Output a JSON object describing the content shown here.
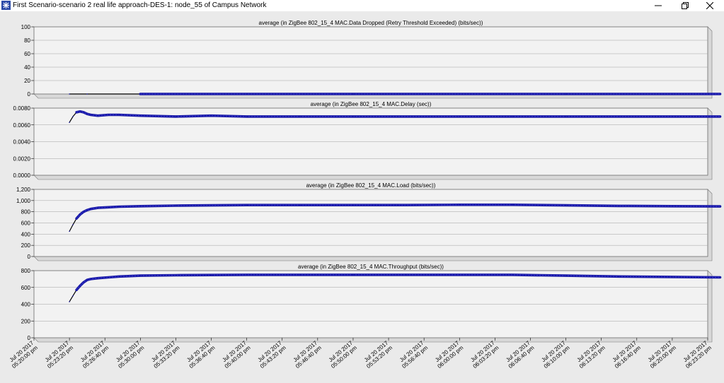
{
  "window": {
    "title": "First Scenario-scenario 2 real life approach-DES-1: node_55 of Campus Network",
    "minimize_icon": "minimize-icon",
    "maximize_icon": "restore-icon",
    "close_icon": "close-icon"
  },
  "colors": {
    "background": "#eaeaea",
    "panel": "#f2f2f2",
    "series": "#1a1aa8",
    "initial_segment": "#000000",
    "grid": "#a0a0a0"
  },
  "chart_data": [
    {
      "type": "line",
      "title": "average (in ZigBee 802_15_4 MAC.Data Dropped (Retry Threshold Exceeded) (bits/sec))",
      "ylim": [
        0,
        100
      ],
      "yticks": [
        0,
        20,
        40,
        60,
        80,
        100
      ],
      "ytick_labels": [
        "0",
        "20",
        "40",
        "60",
        "80",
        "100"
      ],
      "grid": true,
      "x": [
        "05:23:20",
        "05:25:00",
        "05:30:00",
        "05:40:00",
        "05:50:00",
        "06:00:00",
        "06:10:00",
        "06:20:00",
        "06:24:30"
      ],
      "series": [
        {
          "values": [
            0,
            0,
            0,
            0,
            0,
            0,
            0,
            0,
            0
          ]
        }
      ]
    },
    {
      "type": "line",
      "title": "average (in ZigBee 802_15_4 MAC.Delay (sec))",
      "ylim": [
        0,
        0.008
      ],
      "yticks": [
        0,
        0.002,
        0.004,
        0.006,
        0.008
      ],
      "ytick_labels": [
        "0.0000",
        "0.0020",
        "0.0040",
        "0.0060",
        "0.0080"
      ],
      "grid": true,
      "x": [
        "05:23:20",
        "05:23:40",
        "05:24:00",
        "05:24:20",
        "05:24:40",
        "05:25:00",
        "05:25:20",
        "05:26:00",
        "05:27:00",
        "05:28:00",
        "05:30:00",
        "05:33:20",
        "05:36:40",
        "05:40:00",
        "05:45:00",
        "05:50:00",
        "05:55:00",
        "06:00:00",
        "06:05:00",
        "06:10:00",
        "06:15:00",
        "06:20:00",
        "06:24:30"
      ],
      "series": [
        {
          "values": [
            0.0063,
            0.007,
            0.0075,
            0.0076,
            0.0075,
            0.0073,
            0.0072,
            0.0071,
            0.0072,
            0.0072,
            0.0071,
            0.007,
            0.0071,
            0.007,
            0.007,
            0.007,
            0.007,
            0.007,
            0.007,
            0.007,
            0.007,
            0.007,
            0.007
          ]
        }
      ]
    },
    {
      "type": "line",
      "title": "average (in ZigBee 802_15_4 MAC.Load (bits/sec))",
      "ylim": [
        0,
        1200
      ],
      "yticks": [
        0,
        200,
        400,
        600,
        800,
        1000,
        1200
      ],
      "ytick_labels": [
        "0",
        "200",
        "400",
        "600",
        "800",
        "1,000",
        "1,200"
      ],
      "grid": true,
      "x": [
        "05:23:20",
        "05:23:40",
        "05:24:00",
        "05:24:20",
        "05:24:40",
        "05:25:00",
        "05:25:20",
        "05:26:00",
        "05:27:00",
        "05:28:00",
        "05:30:00",
        "05:33:20",
        "05:36:40",
        "05:40:00",
        "05:45:00",
        "05:50:00",
        "05:55:00",
        "06:00:00",
        "06:05:00",
        "06:10:00",
        "06:15:00",
        "06:20:00",
        "06:24:30"
      ],
      "series": [
        {
          "values": [
            450,
            570,
            680,
            750,
            800,
            830,
            850,
            870,
            880,
            890,
            900,
            910,
            915,
            920,
            920,
            920,
            920,
            925,
            925,
            915,
            905,
            900,
            895
          ]
        }
      ]
    },
    {
      "type": "line",
      "title": "average (in ZigBee 802_15_4 MAC.Throughput (bits/sec))",
      "ylim": [
        0,
        800
      ],
      "yticks": [
        0,
        200,
        400,
        600,
        800
      ],
      "ytick_labels": [
        "0",
        "200",
        "400",
        "600",
        "800"
      ],
      "grid": true,
      "x": [
        "05:23:20",
        "05:23:40",
        "05:24:00",
        "05:24:20",
        "05:24:40",
        "05:25:00",
        "05:25:20",
        "05:26:00",
        "05:27:00",
        "05:28:00",
        "05:30:00",
        "05:33:20",
        "05:36:40",
        "05:40:00",
        "05:45:00",
        "05:50:00",
        "05:55:00",
        "06:00:00",
        "06:05:00",
        "06:10:00",
        "06:15:00",
        "06:20:00",
        "06:24:30"
      ],
      "series": [
        {
          "values": [
            430,
            500,
            570,
            620,
            660,
            690,
            700,
            710,
            720,
            730,
            740,
            745,
            748,
            750,
            750,
            750,
            750,
            750,
            750,
            740,
            730,
            725,
            720
          ]
        }
      ]
    }
  ],
  "x_axis": {
    "tick_times": [
      "05:23:20",
      "05:26:40",
      "05:30:00",
      "05:33:20",
      "05:36:40",
      "05:40:00",
      "05:43:20",
      "05:46:40",
      "05:50:00",
      "05:53:20",
      "05:56:40",
      "06:00:00",
      "06:03:20",
      "06:06:40",
      "06:10:00",
      "06:13:20",
      "06:16:40",
      "06:20:00",
      "06:23:20"
    ],
    "tick_label_dates": [
      "Jul 20 2017",
      "Jul 20 2017",
      "Jul 20 2017",
      "Jul 20 2017",
      "Jul 20 2017",
      "Jul 20 2017",
      "Jul 20 2017",
      "Jul 20 2017",
      "Jul 20 2017",
      "Jul 20 2017",
      "Jul 20 2017",
      "Jul 20 2017",
      "Jul 20 2017",
      "Jul 20 2017",
      "Jul 20 2017",
      "Jul 20 2017",
      "Jul 20 2017",
      "Jul 20 2017",
      "Jul 20 2017",
      "Jul 20 2017"
    ],
    "tick_label_times": [
      "05:20:00 pm",
      "05:23:20 pm",
      "05:26:40 pm",
      "05:30:00 pm",
      "05:33:20 pm",
      "05:36:40 pm",
      "05:40:00 pm",
      "05:43:20 pm",
      "05:46:40 pm",
      "05:50:00 pm",
      "05:53:20 pm",
      "05:56:40 pm",
      "06:00:00 pm",
      "06:03:20 pm",
      "06:06:40 pm",
      "06:10:00 pm",
      "06:13:20 pm",
      "06:16:40 pm",
      "06:20:00 pm",
      "06:23:20 pm"
    ],
    "range_start": "05:20:00",
    "range_end": "06:23:20"
  }
}
